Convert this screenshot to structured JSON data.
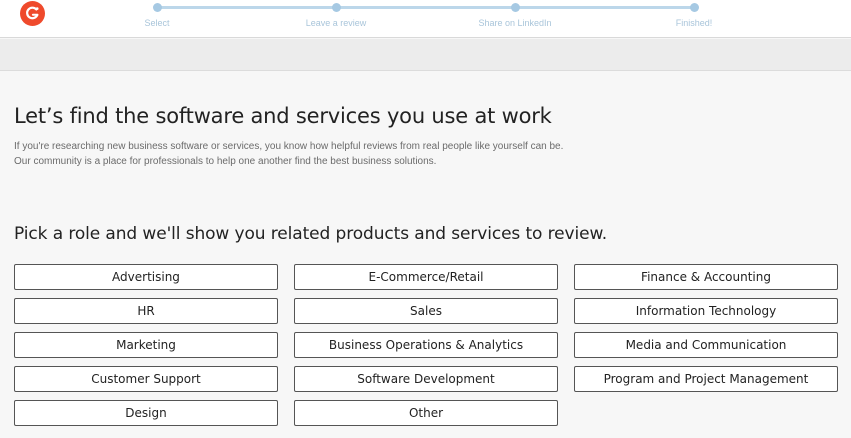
{
  "header": {
    "logo_icon": "g2-logo-icon",
    "steps": [
      {
        "label": "Select"
      },
      {
        "label": "Leave a review"
      },
      {
        "label": "Share on LinkedIn"
      },
      {
        "label": "Finished!"
      }
    ]
  },
  "main": {
    "title": "Let’s find the software and services you use at work",
    "intro_line1": "If you're researching new business software or services, you know how helpful reviews from real people like yourself can be.",
    "intro_line2": "Our community is a place for professionals to help one another find the best business solutions.",
    "roles_heading": "Pick a role and we'll show you related products and services to review.",
    "roles": [
      {
        "label": "Advertising"
      },
      {
        "label": "E-Commerce/Retail"
      },
      {
        "label": "Finance & Accounting"
      },
      {
        "label": "HR"
      },
      {
        "label": "Sales"
      },
      {
        "label": "Information Technology"
      },
      {
        "label": "Marketing"
      },
      {
        "label": "Business Operations & Analytics"
      },
      {
        "label": "Media and Communication"
      },
      {
        "label": "Customer Support"
      },
      {
        "label": "Software Development"
      },
      {
        "label": "Program and Project Management"
      },
      {
        "label": "Design"
      },
      {
        "label": "Other"
      }
    ]
  },
  "colors": {
    "brand": "#ef4a2c",
    "progress": "#a6c9e3",
    "background": "#f7f7f7"
  }
}
